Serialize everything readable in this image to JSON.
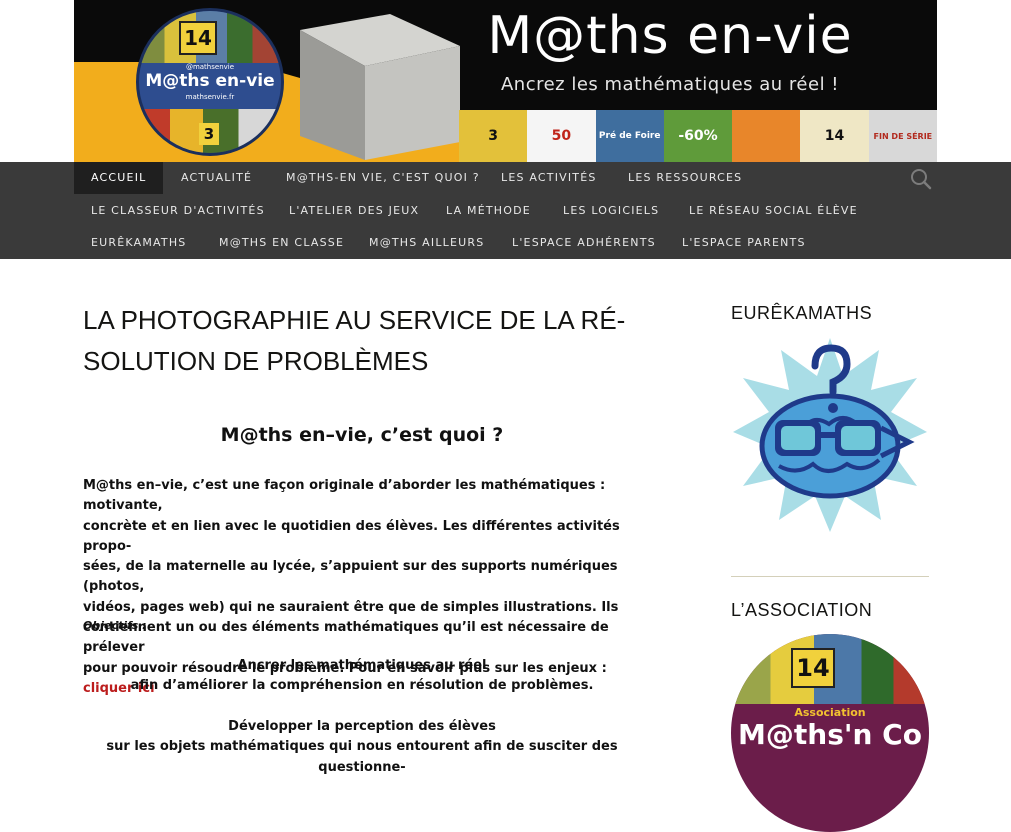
{
  "header": {
    "title": "M@ths en-vie",
    "tagline": "Ancrez les mathématiques au réel !",
    "logo": {
      "handle": "@mathsenvie",
      "name": "M@ths en-vie",
      "site": "mathsenvie.fr",
      "badge_number": "14",
      "badge_number_2": "3"
    },
    "strip_labels": [
      "3",
      "50",
      "Pré de Foire",
      "-60%",
      "",
      "14",
      "FIN DE SÉRIE"
    ]
  },
  "nav": {
    "items": [
      {
        "label": "Accueil",
        "active": true
      },
      {
        "label": "Actualité"
      },
      {
        "label": "M@ths-en vie, c'est quoi ?"
      },
      {
        "label": "Les activités"
      },
      {
        "label": "Les ressources"
      },
      {
        "label": "Le classeur d'activités"
      },
      {
        "label": "L'atelier des jeux"
      },
      {
        "label": "La méthode"
      },
      {
        "label": "Les logiciels"
      },
      {
        "label": "Le réseau social élève"
      },
      {
        "label": "EurêkaMaths"
      },
      {
        "label": "M@ths en classe"
      },
      {
        "label": "M@ths ailleurs"
      },
      {
        "label": "L'espace adhérents"
      },
      {
        "label": "L'espace parents"
      }
    ],
    "search_icon": "search-icon"
  },
  "post": {
    "title_line1": "LA PHOTOGRAPHIE AU SERVICE DE LA RÉ-",
    "title_line2": "SOLUTION DE PROBLÈMES",
    "heading": "M@ths en–vie, c’est quoi ?",
    "intro_lines": [
      "M@ths en–vie, c’est une façon originale d’aborder les mathématiques : motivante,",
      "concrète et en lien avec le quotidien des élèves. Les différentes activités propo-",
      "sées, de la maternelle au lycée, s’appuient sur des supports numériques (photos,",
      "vidéos, pages web) qui ne sauraient être que de simples illustrations. Ils",
      "contiennent un ou des éléments mathématiques qu’il est nécessaire de prélever",
      "pour pouvoir résoudre le problème. Pour en savoir plus sur les enjeux : "
    ],
    "intro_link": "cliquer ici",
    "objectives_label": "Objectifs :",
    "objective1_line1": "Ancrer les mathématiques au réel",
    "objective1_line2": "afin d’améliorer la compréhension en résolution de problèmes.",
    "objective2_line1": "Développer la perception des élèves",
    "objective2_line2": "sur les objets mathématiques qui nous entourent afin de susciter des questionne-"
  },
  "sidebar": {
    "widget1_title": "EurêkaMaths",
    "widget2_title": "L’association",
    "assoc_sub": "Association",
    "assoc_name": "M@ths'n Co",
    "assoc_badge": "14"
  },
  "colors": {
    "nav_bg": "#3a3a3a",
    "nav_active": "#1f1f1f",
    "link": "#bc1d1d",
    "banner_yellow": "#f2ad1c",
    "assoc_purple": "#6b1d4a"
  }
}
